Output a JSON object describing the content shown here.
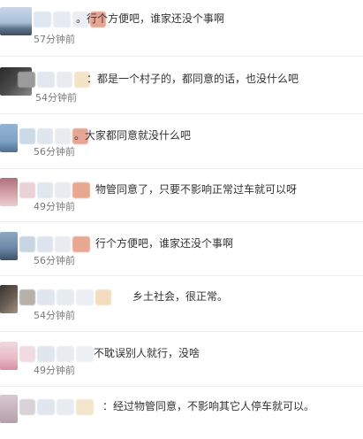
{
  "comments": [
    {
      "text": "。行个方便吧，谁家还没个事啊",
      "time": "57分钟前"
    },
    {
      "text": "：都是一个村子的，都同意的话，也没什么吧",
      "time": "54分钟前"
    },
    {
      "text": "。大家都同意就没什么吧",
      "time": "56分钟前"
    },
    {
      "text": "物管同意了，只要不影响正常过车就可以呀",
      "time": "49分钟前"
    },
    {
      "text": "行个方便吧，谁家还没个事啊",
      "time": "56分钟前"
    },
    {
      "text": "乡土社会，很正常。",
      "time": "54分钟前"
    },
    {
      "text": "不耽误别人就行，没啥",
      "time": "49分钟前"
    },
    {
      "text": "：经过物管同意，不影响其它人停车就可以。",
      "time": ""
    }
  ],
  "colors": {
    "text": "#333333",
    "time": "#7a7a7a",
    "separator": "#ececec"
  }
}
